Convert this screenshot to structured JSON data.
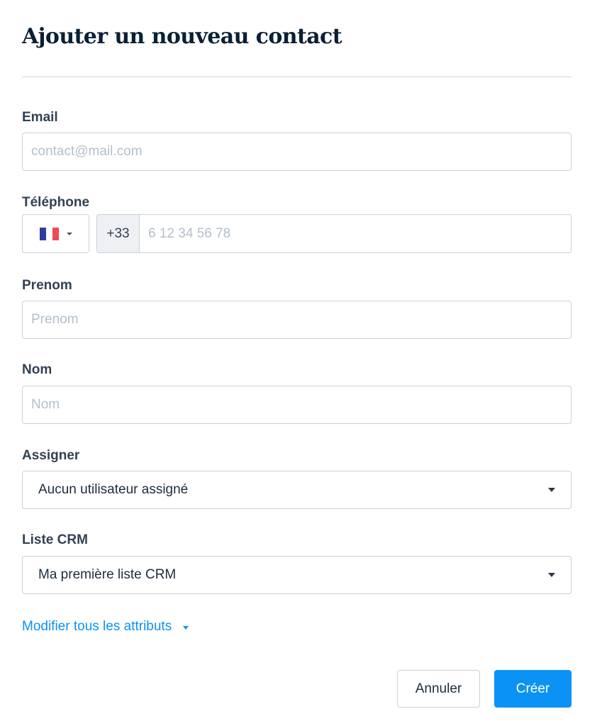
{
  "dialog": {
    "title": "Ajouter un nouveau contact"
  },
  "email": {
    "label": "Email",
    "placeholder": "contact@mail.com"
  },
  "phone": {
    "label": "Téléphone",
    "dial_code": "+33",
    "placeholder": "6 12 34 56 78",
    "flag_colors": {
      "blue": "#2c3ea0",
      "white": "#ffffff",
      "red": "#ef4a55"
    }
  },
  "first_name": {
    "label": "Prenom",
    "placeholder": "Prenom"
  },
  "last_name": {
    "label": "Nom",
    "placeholder": "Nom"
  },
  "assign": {
    "label": "Assigner",
    "selected": "Aucun utilisateur assigné"
  },
  "crm_list": {
    "label": "Liste CRM",
    "selected": "Ma première liste CRM"
  },
  "attributes_link": {
    "label": "Modifier tous les attributs"
  },
  "actions": {
    "cancel_label": "Annuler",
    "create_label": "Créer"
  },
  "colors": {
    "accent": "#0a92f5",
    "border": "#c9d1da",
    "placeholder": "#b4bfcb"
  }
}
